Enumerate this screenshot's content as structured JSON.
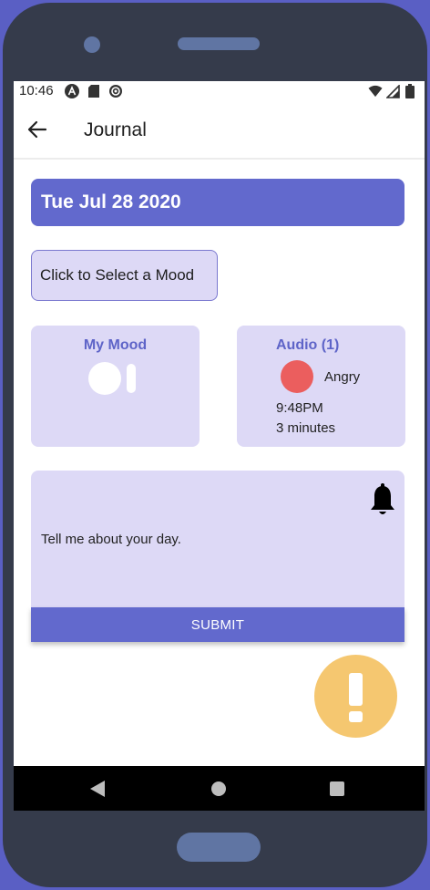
{
  "status_bar": {
    "time": "10:46",
    "left_icons": [
      "a-badge-icon",
      "sd-card-icon",
      "sync-icon"
    ],
    "right_icons": [
      "wifi-icon",
      "signal-icon",
      "battery-icon"
    ]
  },
  "app_bar": {
    "title": "Journal",
    "back_icon": "arrow-left-icon"
  },
  "entry": {
    "date": "Tue Jul 28 2020",
    "mood_select_label": "Click to Select a Mood"
  },
  "mood_card": {
    "title": "My Mood"
  },
  "audio_card": {
    "title": "Audio (1)",
    "emotion": "Angry",
    "emotion_color": "#eb5e5e",
    "time": "9:48PM",
    "duration": "3 minutes"
  },
  "journal": {
    "prompt": "Tell me about your day.",
    "reminder_icon": "bell-icon"
  },
  "actions": {
    "submit_label": "SUBMIT",
    "fab_icon": "exclamation-icon"
  },
  "colors": {
    "primary": "#6269cd",
    "card_background": "#ddd9f6",
    "fab": "#f5c770"
  },
  "nav_bar": {
    "buttons": [
      "back-triangle-icon",
      "home-circle-icon",
      "recents-square-icon"
    ]
  }
}
